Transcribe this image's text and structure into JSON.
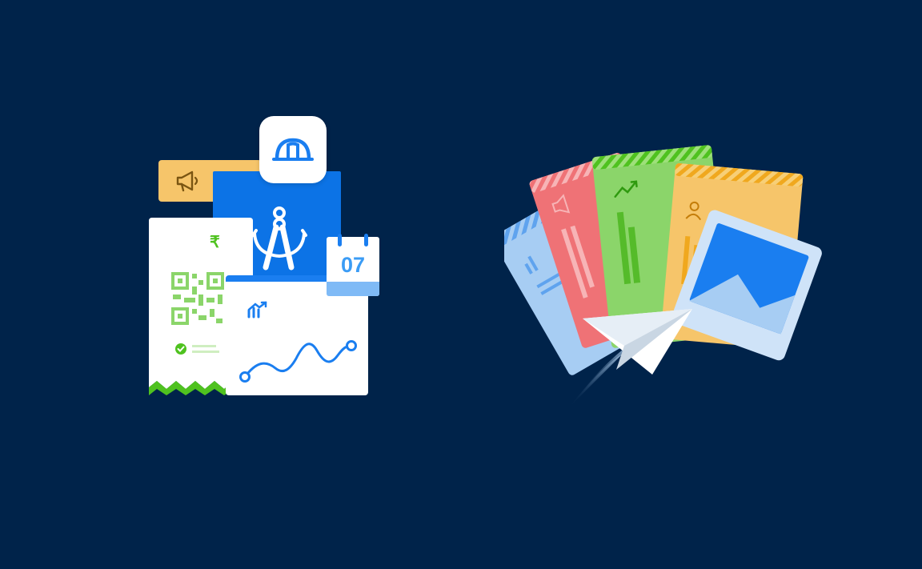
{
  "calendar": {
    "day": "07"
  },
  "receipt": {
    "currency_symbol": "₹"
  },
  "icons": {
    "megaphone": "megaphone-icon",
    "hardhat": "hardhat-icon",
    "compass": "compass-icon",
    "qr": "qr-code-icon",
    "check": "check-icon",
    "trend": "trend-up-icon",
    "paper_plane": "paper-plane-icon",
    "image": "image-icon",
    "user": "user-icon"
  },
  "colors": {
    "background": "#00234a",
    "blue": "#1a7ef0",
    "yellow": "#f6c56a",
    "green": "#62c93a",
    "red": "#ef7276",
    "light_blue": "#a7cdf3"
  }
}
